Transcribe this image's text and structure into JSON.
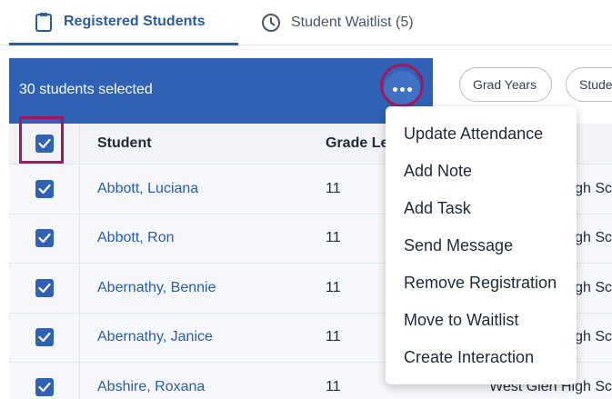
{
  "tabs": [
    {
      "label": "Registered Students",
      "icon": "clipboard-icon",
      "active": true
    },
    {
      "label": "Student Waitlist (5)",
      "icon": "clock-icon",
      "active": false
    }
  ],
  "selection_bar": {
    "count_text": "30 students selected",
    "more_icon": "ellipsis-icon"
  },
  "filters": [
    {
      "label": "Grad Years"
    },
    {
      "label": "Stude"
    }
  ],
  "table": {
    "headers": {
      "student": "Student",
      "grade": "Grade Le",
      "school": ""
    },
    "rows": [
      {
        "student": "Abbott, Luciana",
        "grade": "11",
        "school": "igh Sc"
      },
      {
        "student": "Abbott, Ron",
        "grade": "11",
        "school": "igh Sc"
      },
      {
        "student": "Abernathy, Bennie",
        "grade": "11",
        "school": "igh Sc"
      },
      {
        "student": "Abernathy, Janice",
        "grade": "11",
        "school": "igh Sc"
      },
      {
        "student": "Abshire, Roxana",
        "grade": "11",
        "school": "West Glen High Sc"
      }
    ]
  },
  "menu": {
    "items": [
      {
        "label": "Update Attendance"
      },
      {
        "label": "Add Note"
      },
      {
        "label": "Add Task"
      },
      {
        "label": "Send Message"
      },
      {
        "label": "Remove Registration"
      },
      {
        "label": "Move to Waitlist"
      },
      {
        "label": "Create Interaction"
      }
    ]
  },
  "colors": {
    "primary": "#2f62b5",
    "highlight": "#a3175f",
    "link": "#2a5caa"
  }
}
